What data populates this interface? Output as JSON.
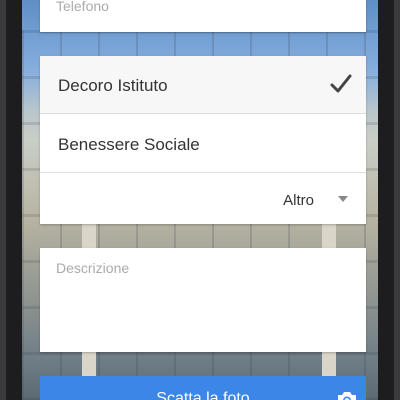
{
  "form": {
    "phone_placeholder": "Telefono",
    "categories": [
      {
        "label": "Decoro Istituto",
        "selected": true
      },
      {
        "label": "Benessere Sociale",
        "selected": false
      }
    ],
    "other_select": {
      "selected_value": "Altro"
    },
    "description_placeholder": "Descrizione",
    "photo_button_label": "Scatta la foto"
  },
  "colors": {
    "button_blue": "#3b86e6",
    "card_white": "#ffffff",
    "placeholder_gray": "#aaaaaa",
    "text_dark": "#333333"
  },
  "icons": {
    "selected_marker": "check-icon",
    "select_arrow": "chevron-down-icon",
    "photo": "camera-icon"
  }
}
